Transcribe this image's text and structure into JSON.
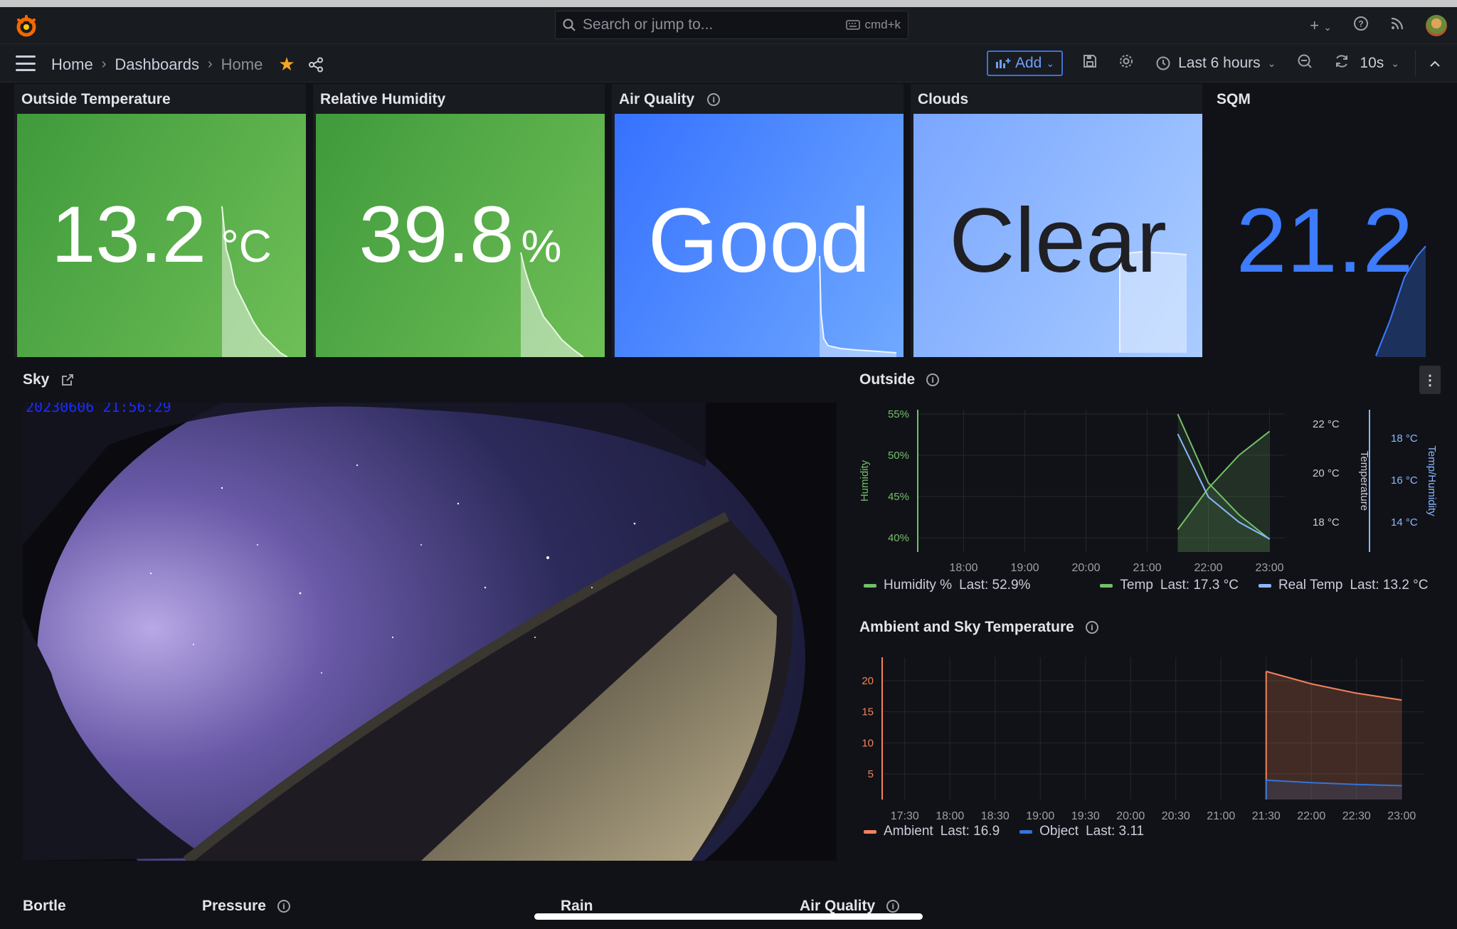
{
  "topbar": {
    "search_placeholder": "Search or jump to...",
    "search_shortcut": "cmd+k",
    "plus_label": "+"
  },
  "nav": {
    "breadcrumbs": [
      "Home",
      "Dashboards",
      "Home"
    ],
    "add_label": "Add",
    "time_range": "Last 6 hours",
    "refresh_interval": "10s"
  },
  "stats": [
    {
      "title": "Outside Temperature",
      "value": "13.2",
      "unit": "°C",
      "color": "#56a64b"
    },
    {
      "title": "Relative Humidity",
      "value": "39.8",
      "unit": "%",
      "color": "#56a64b"
    },
    {
      "title": "Air Quality",
      "value": "Good",
      "unit": "",
      "color": "#3d7bff"
    },
    {
      "title": "Clouds",
      "value": "Clear",
      "unit": "",
      "color": "#8ab8ff"
    },
    {
      "title": "SQM",
      "value": "21.2",
      "unit": "",
      "color": "#3d7bff"
    }
  ],
  "sky": {
    "title": "Sky",
    "timestamp": "20230606 21:56:29"
  },
  "outside": {
    "title": "Outside",
    "legend": [
      {
        "label": "Humidity %",
        "last": "Last: 52.9%",
        "color": "#73bf69"
      },
      {
        "label": "Temp",
        "last": "Last: 17.3 °C",
        "color": "#73bf69"
      },
      {
        "label": "Real Temp",
        "last": "Last: 13.2 °C",
        "color": "#8ab8ff"
      }
    ]
  },
  "ambient": {
    "title": "Ambient and Sky Temperature",
    "legend": [
      {
        "label": "Ambient",
        "last": "Last: 16.9",
        "color": "#f2835b"
      },
      {
        "label": "Object",
        "last": "Last: 3.11",
        "color": "#3274d9"
      }
    ]
  },
  "bottom_panels": [
    "Bortle",
    "Pressure",
    "Rain",
    "Air Quality"
  ],
  "chart_data": [
    {
      "type": "line",
      "title": "Outside",
      "x": [
        "18:00",
        "19:00",
        "20:00",
        "21:00",
        "22:00",
        "23:00"
      ],
      "y_axes": [
        {
          "label": "Humidity",
          "ticks": [
            "55%",
            "50%",
            "45%",
            "40%"
          ],
          "color": "#73bf69"
        },
        {
          "label": "Temperature",
          "ticks": [
            "22 °C",
            "20 °C",
            "18 °C"
          ],
          "color": "#ccccdc"
        },
        {
          "label": "Temp/Humidity",
          "ticks": [
            "18 °C",
            "16 °C",
            "14 °C"
          ],
          "color": "#8ab8ff"
        }
      ],
      "series": [
        {
          "name": "Humidity %",
          "points": [
            [
              "21:30",
              41
            ],
            [
              "22:00",
              46
            ],
            [
              "22:30",
              50
            ],
            [
              "23:00",
              52.9
            ]
          ]
        },
        {
          "name": "Temp",
          "points": [
            [
              "21:30",
              22.4
            ],
            [
              "22:00",
              19.6
            ],
            [
              "22:30",
              18.3
            ],
            [
              "23:00",
              17.3
            ]
          ]
        },
        {
          "name": "Real Temp",
          "points": [
            [
              "21:30",
              18.2
            ],
            [
              "22:00",
              15.2
            ],
            [
              "22:30",
              14.0
            ],
            [
              "23:00",
              13.2
            ]
          ]
        }
      ]
    },
    {
      "type": "area",
      "title": "Ambient and Sky Temperature",
      "x": [
        "17:30",
        "18:00",
        "18:30",
        "19:00",
        "19:30",
        "20:00",
        "20:30",
        "21:00",
        "21:30",
        "22:00",
        "22:30",
        "23:00"
      ],
      "y_ticks": [
        20,
        15,
        10,
        5
      ],
      "series": [
        {
          "name": "Ambient",
          "points": [
            [
              "21:30",
              21.5
            ],
            [
              "22:00",
              19.5
            ],
            [
              "22:30",
              18.0
            ],
            [
              "23:00",
              16.9
            ]
          ]
        },
        {
          "name": "Object",
          "points": [
            [
              "21:30",
              4.0
            ],
            [
              "22:00",
              3.6
            ],
            [
              "22:30",
              3.3
            ],
            [
              "23:00",
              3.11
            ]
          ]
        }
      ]
    }
  ]
}
